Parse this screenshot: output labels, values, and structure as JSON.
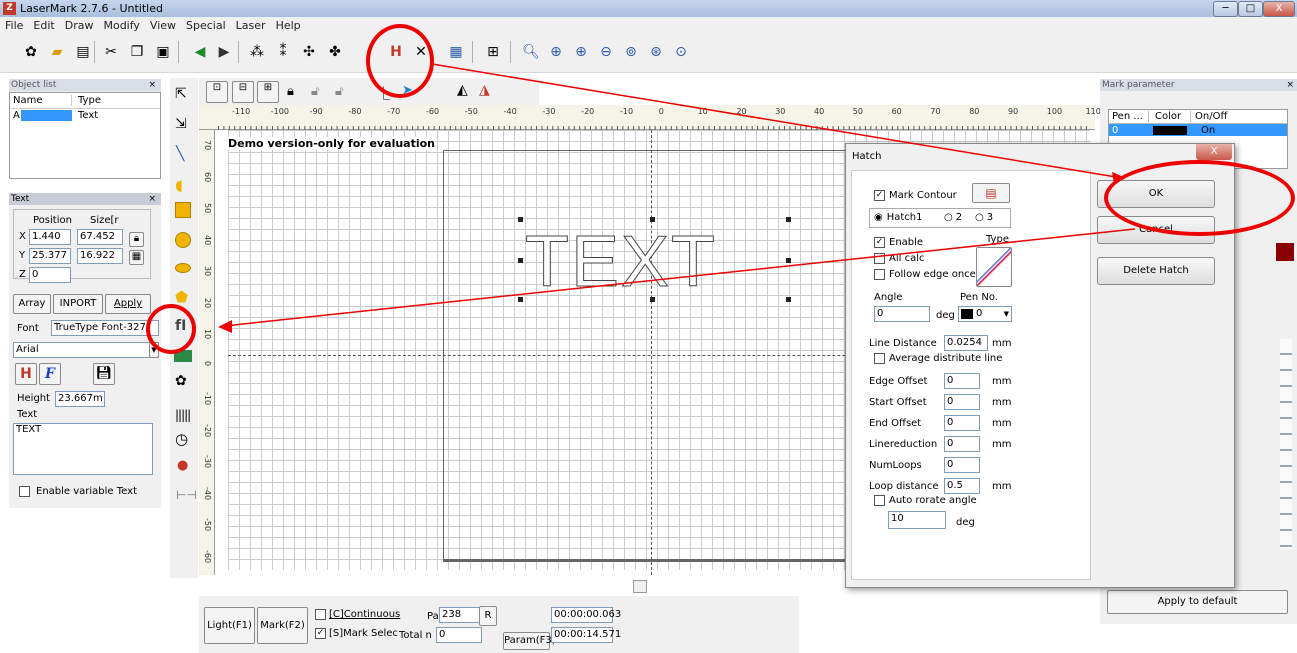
{
  "window": {
    "title": "LaserMark 2.7.6 - Untitled",
    "min": "─",
    "max": "□",
    "close": "X"
  },
  "menu": [
    "File",
    "Edit",
    "Draw",
    "Modify",
    "View",
    "Special",
    "Laser",
    "Help"
  ],
  "object_list": {
    "title": "Object list",
    "close": "×",
    "col_name": "Name",
    "col_type": "Type",
    "rows": [
      {
        "name": "A",
        "type": "Text"
      }
    ]
  },
  "text_panel": {
    "title": "Text",
    "close": "×",
    "position": "Position",
    "size": "Size[r",
    "x_label": "X",
    "x_pos": "1.440",
    "x_size": "67.452",
    "y_label": "Y",
    "y_pos": "25.377",
    "y_size": "16.922",
    "z_label": "Z",
    "z_pos": "0",
    "array": "Array",
    "inport": "INPORT",
    "apply": "Apply",
    "font_label": "Font",
    "font_type": "TrueType Font-327",
    "font_name": "Arial",
    "bold_glyph": "F",
    "height_label": "Height",
    "height_value": "23.667m",
    "text_label": "Text",
    "text_value": "TEXT",
    "enable_variable": "Enable variable Text"
  },
  "canvas": {
    "demo_notice": "Demo version-only for evaluation",
    "text_object": "TEXT",
    "ruler_ticks": [
      "-110",
      "-100",
      "-90",
      "-80",
      "-70",
      "-60",
      "-50",
      "-40",
      "-30",
      "-20",
      "-10",
      "0",
      "10",
      "20",
      "30",
      "40",
      "50",
      "60",
      "70",
      "80",
      "90",
      "100",
      "110"
    ],
    "ruler_v": [
      "70",
      "60",
      "50",
      "40",
      "30",
      "20",
      "10",
      "0",
      "-10",
      "-20",
      "-30",
      "-40",
      "-50",
      "-60"
    ]
  },
  "bottom": {
    "light": "Light(F1)",
    "mark": "Mark(F2)",
    "continuous": "[C]Continuous",
    "part_label": "Part",
    "part_value": "238",
    "r_button": "R",
    "mark_select": "[S]Mark Selec",
    "total_label": "Total n",
    "total_value": "0",
    "param": "Param(F3)",
    "time1": "00:00:00.063",
    "time2": "00:00:14.571"
  },
  "mark_param": {
    "title": "Mark parameter",
    "close": "×",
    "col_pen": "Pen ...",
    "col_color": "Color",
    "col_onoff": "On/Off",
    "row_pen": "0",
    "row_onoff": "On",
    "apply_default": "Apply to default"
  },
  "hatch": {
    "title": "Hatch",
    "close": "X",
    "mark_contour": "Mark Contour",
    "hatch1": "Hatch1",
    "hatch2": "2",
    "hatch3": "3",
    "enable": "Enable",
    "type_label": "Type",
    "all_calc": "All calc",
    "follow_edge": "Follow edge once",
    "angle_label": "Angle",
    "angle_value": "0",
    "deg": "deg",
    "pen_label": "Pen No.",
    "pen_value": "0",
    "line_distance_label": "Line Distance",
    "line_distance_value": "0.0254",
    "mm": "mm",
    "avg_distribute": "Average distribute line",
    "edge_offset_label": "Edge Offset",
    "edge_offset_value": "0",
    "start_offset_label": "Start Offset",
    "start_offset_value": "0",
    "end_offset_label": "End Offset",
    "end_offset_value": "0",
    "linereduction_label": "Linereduction",
    "linereduction_value": "0",
    "numloops_label": "NumLoops",
    "numloops_value": "0",
    "loop_distance_label": "Loop distance",
    "loop_distance_value": "0.5",
    "auto_rotate": "Auto rorate angle",
    "auto_rotate_value": "10",
    "ok": "OK",
    "cancel": "Cancel",
    "delete": "Delete Hatch"
  }
}
